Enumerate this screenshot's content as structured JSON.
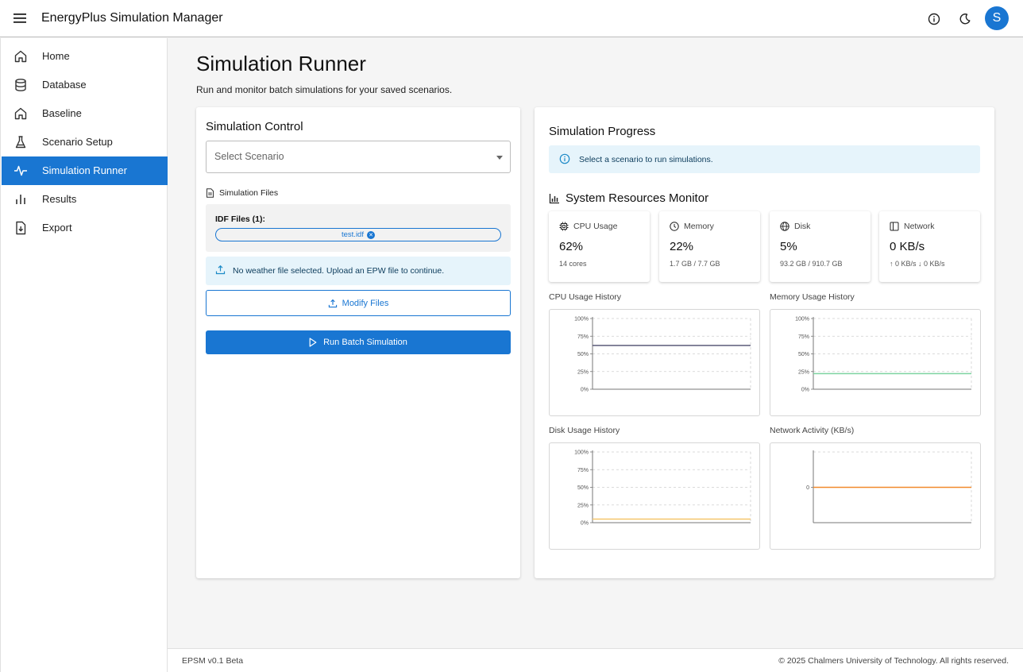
{
  "app": {
    "title": "EnergyPlus Simulation Manager",
    "avatar_initial": "S"
  },
  "sidebar": {
    "items": [
      {
        "label": "Home",
        "icon": "home-icon"
      },
      {
        "label": "Database",
        "icon": "database-icon"
      },
      {
        "label": "Baseline",
        "icon": "home-icon"
      },
      {
        "label": "Scenario Setup",
        "icon": "flask-icon"
      },
      {
        "label": "Simulation Runner",
        "icon": "activity-icon",
        "active": true
      },
      {
        "label": "Results",
        "icon": "bar-chart-icon"
      },
      {
        "label": "Export",
        "icon": "file-export-icon"
      }
    ]
  },
  "page": {
    "title": "Simulation Runner",
    "subtitle": "Run and monitor batch simulations for your saved scenarios."
  },
  "control": {
    "title": "Simulation Control",
    "select_placeholder": "Select Scenario",
    "files_heading": "Simulation Files",
    "idf_label": "IDF Files (1):",
    "idf_file": "test.idf",
    "weather_alert": "No weather file selected. Upload an EPW file to continue.",
    "modify_label": "Modify Files",
    "run_label": "Run Batch Simulation"
  },
  "progress": {
    "title": "Simulation Progress",
    "alert": "Select a scenario to run simulations.",
    "resources_title": "System Resources Monitor",
    "stats": [
      {
        "label": "CPU Usage",
        "value": "62%",
        "sub": "14 cores",
        "icon": "cpu-icon"
      },
      {
        "label": "Memory",
        "value": "22%",
        "sub": "1.7 GB / 7.7 GB",
        "icon": "clock-icon"
      },
      {
        "label": "Disk",
        "value": "5%",
        "sub": "93.2 GB / 910.7 GB",
        "icon": "globe-icon"
      },
      {
        "label": "Network",
        "value": "0 KB/s",
        "sub": "↑ 0 KB/s ↓ 0 KB/s",
        "icon": "network-icon"
      }
    ]
  },
  "chart_data": [
    {
      "type": "line",
      "title": "CPU Usage History",
      "ylim": [
        0,
        100
      ],
      "yticks": [
        "0%",
        "25%",
        "50%",
        "75%",
        "100%"
      ],
      "series": [
        {
          "values": [
            62,
            62
          ],
          "color": "#5b5b7a"
        }
      ]
    },
    {
      "type": "line",
      "title": "Memory Usage History",
      "ylim": [
        0,
        100
      ],
      "yticks": [
        "0%",
        "25%",
        "50%",
        "75%",
        "100%"
      ],
      "series": [
        {
          "values": [
            22,
            22
          ],
          "color": "#7dd3a0"
        }
      ]
    },
    {
      "type": "line",
      "title": "Disk Usage History",
      "ylim": [
        0,
        100
      ],
      "yticks": [
        "0%",
        "25%",
        "50%",
        "75%",
        "100%"
      ],
      "series": [
        {
          "values": [
            5,
            5
          ],
          "color": "#f5c66a"
        }
      ]
    },
    {
      "type": "line",
      "title": "Network Activity (KB/s)",
      "ylim": [
        -1,
        1
      ],
      "yticks": [
        "0"
      ],
      "ytick_values": [
        0
      ],
      "series": [
        {
          "values": [
            0,
            0
          ],
          "color": "#f28a2b"
        }
      ]
    }
  ],
  "footer": {
    "version": "EPSM v0.1 Beta",
    "copyright": "© 2025 Chalmers University of Technology. All rights reserved."
  }
}
